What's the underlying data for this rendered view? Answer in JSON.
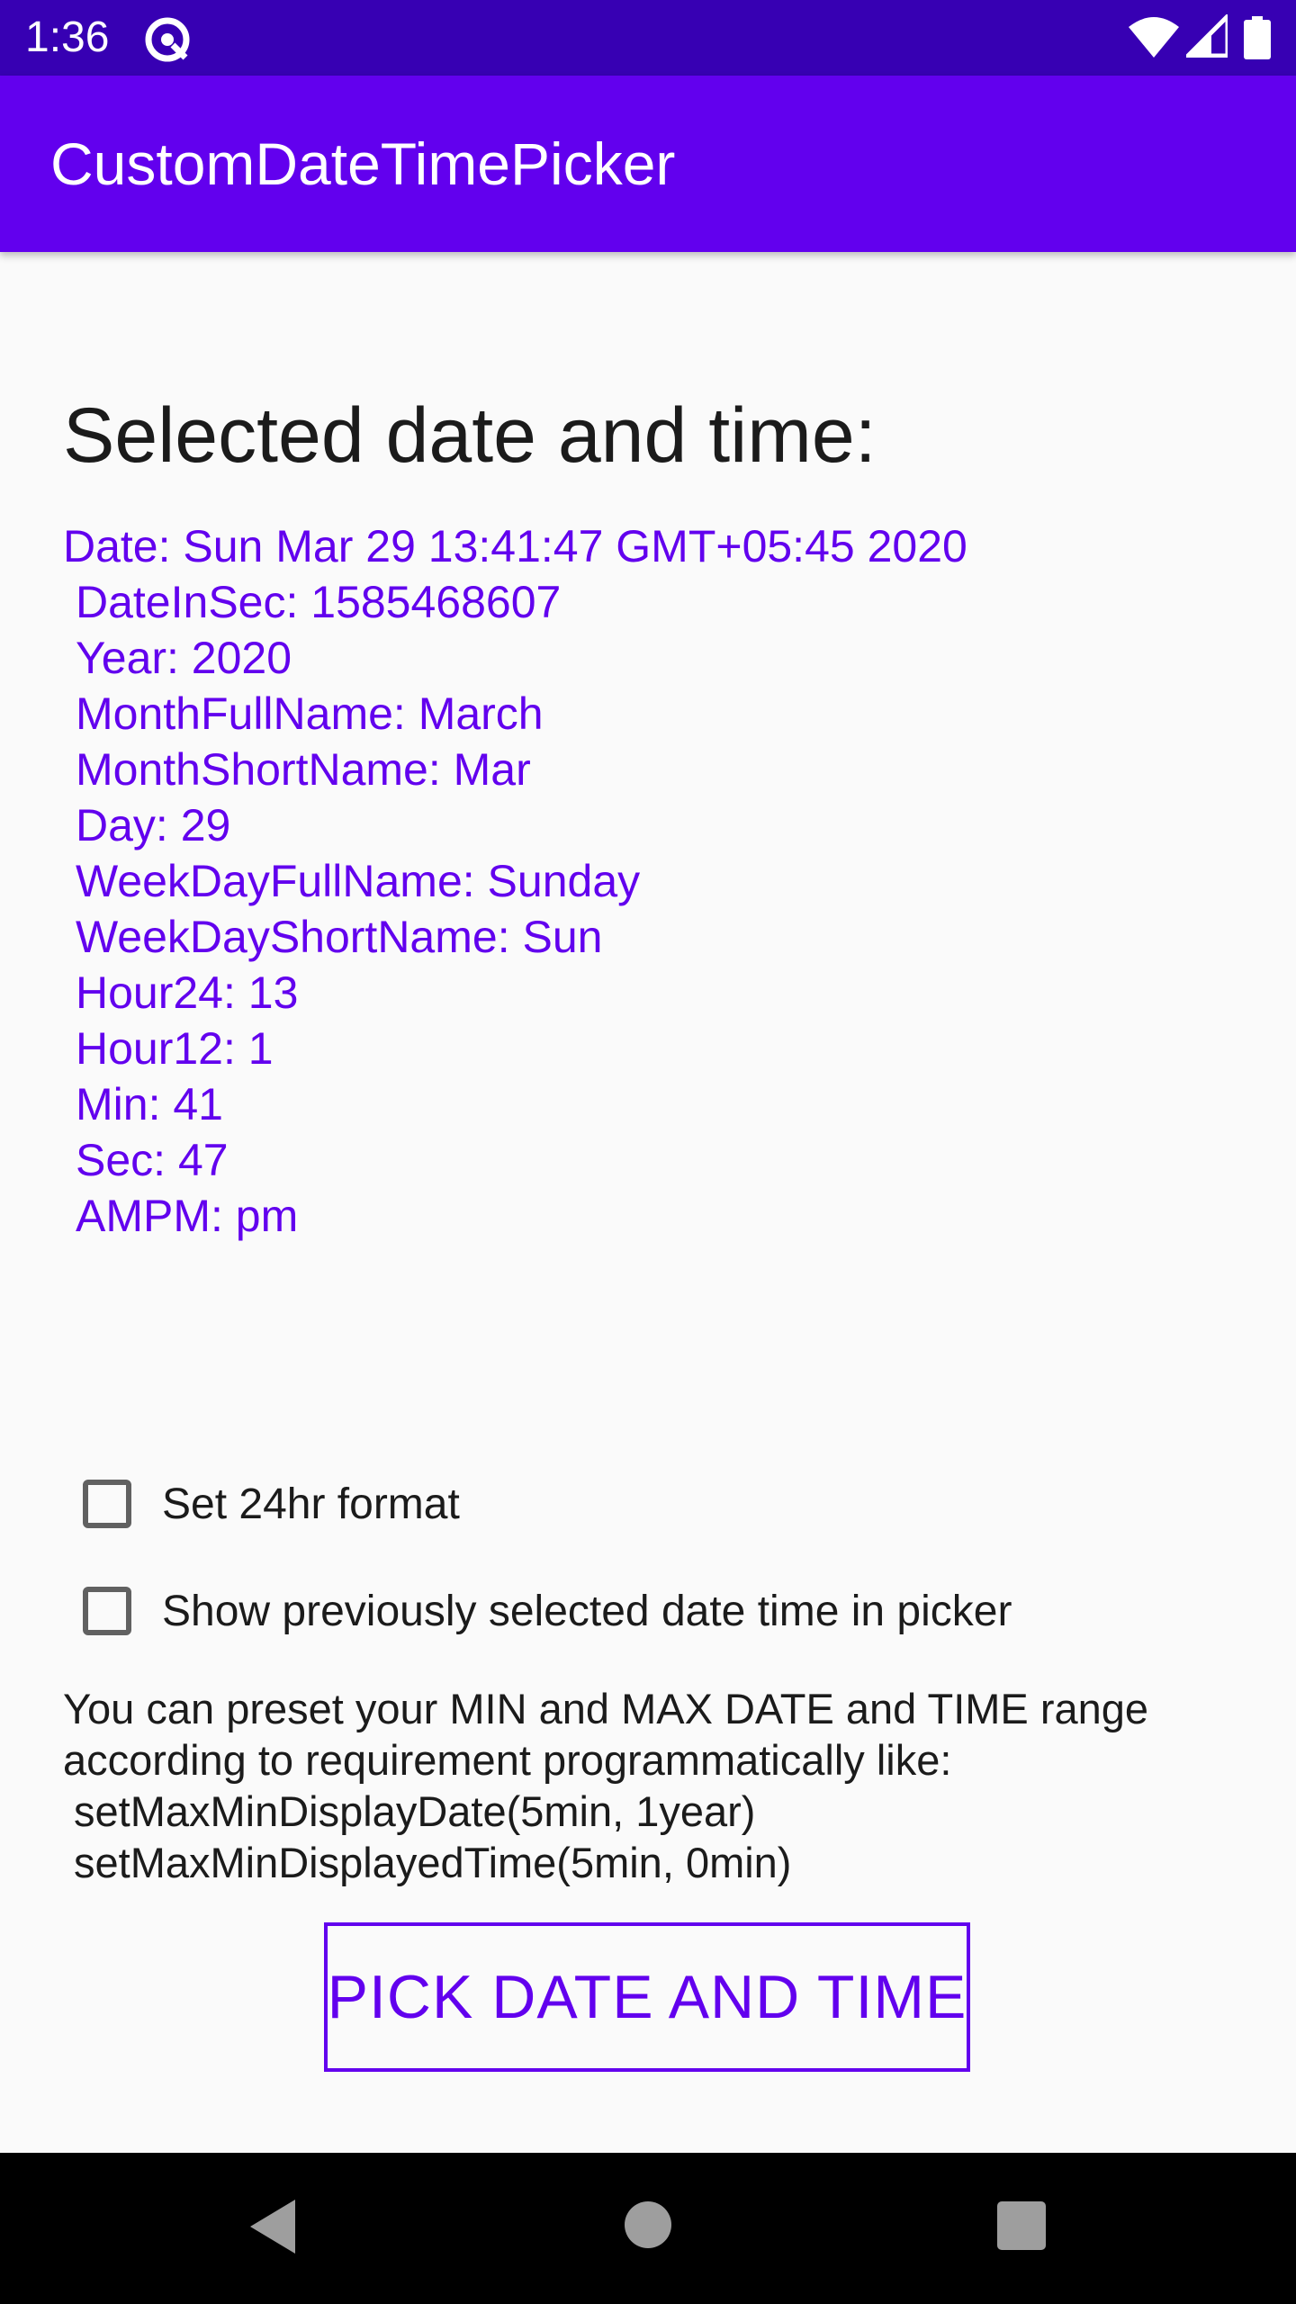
{
  "status_bar": {
    "time": "1:36",
    "icons": [
      "app-notification-icon",
      "wifi-icon",
      "cell-signal-icon",
      "battery-icon"
    ],
    "color": "#3700b3"
  },
  "app_bar": {
    "title": "CustomDateTimePicker",
    "color": "#6200ee"
  },
  "main": {
    "heading": "Selected date and time:",
    "details": [
      "Date: Sun Mar 29 13:41:47 GMT+05:45 2020",
      "DateInSec: 1585468607",
      "Year: 2020",
      "MonthFullName: March",
      "MonthShortName: Mar",
      "Day: 29",
      "WeekDayFullName: Sunday",
      "WeekDayShortName: Sun",
      "Hour24: 13",
      "Hour12: 1",
      "Min: 41",
      "Sec: 47",
      "AMPM: pm"
    ],
    "checkboxes": [
      {
        "label": "Set 24hr format",
        "checked": false
      },
      {
        "label": "Show previously selected date time in picker",
        "checked": false
      }
    ],
    "info_lines": [
      "You can preset your MIN and MAX DATE and TIME range",
      "according to requirement programmatically like:",
      "setMaxMinDisplayDate(5min, 1year)",
      "setMaxMinDisplayedTime(5min, 0min)"
    ],
    "button_label": "PICK DATE AND TIME",
    "accent": "#6200ee"
  },
  "nav_bar": {
    "icons": [
      "back-icon",
      "home-icon",
      "recents-icon"
    ]
  }
}
